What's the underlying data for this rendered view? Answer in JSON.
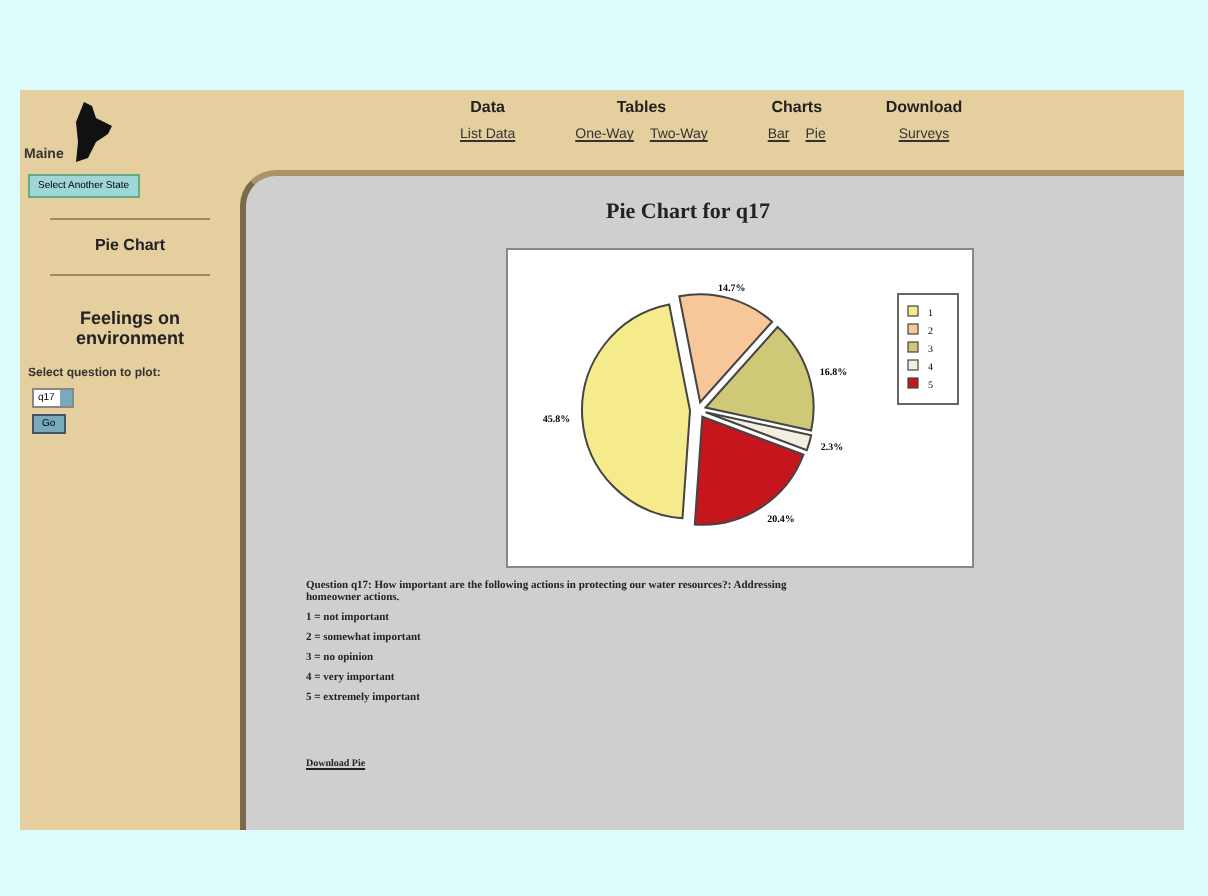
{
  "site": {
    "state": "Maine",
    "change_button": "Select Another State"
  },
  "nav": [
    {
      "heading": "Data",
      "links": [
        "List Data"
      ]
    },
    {
      "heading": "Tables",
      "links": [
        "One-Way",
        "Two-Way"
      ]
    },
    {
      "heading": "Charts",
      "links": [
        "Bar",
        "Pie"
      ]
    },
    {
      "heading": "Download",
      "links": [
        "Surveys"
      ]
    }
  ],
  "sidebar": {
    "section": "Pie Chart",
    "topic": "Feelings on environment",
    "select_label": "Select question to plot:",
    "question_value": "q17",
    "go_button": "Go"
  },
  "main": {
    "title": "Pie Chart for q17",
    "chart_data": {
      "type": "pie",
      "categories": [
        "1",
        "2",
        "3",
        "4",
        "5"
      ],
      "values": [
        45.8,
        14.7,
        16.8,
        2.3,
        20.4
      ],
      "data_labels": true,
      "value_labels": [
        "45.8%",
        "14.7%",
        "16.8%",
        "2.3%",
        "20.4%"
      ],
      "legend": true,
      "colors": [
        "#f5eb8c",
        "#f7c79a",
        "#cfc876",
        "#f3efe0",
        "#c4161c"
      ]
    },
    "question": "Question q17: How important are the following actions in protecting our water resources?: Addressing homeowner actions.",
    "options": [
      "1 = not important",
      "2 = somewhat important",
      "3 = no opinion",
      "4 = very important",
      "5 = extremely important"
    ],
    "download_link": "Download Pie"
  }
}
